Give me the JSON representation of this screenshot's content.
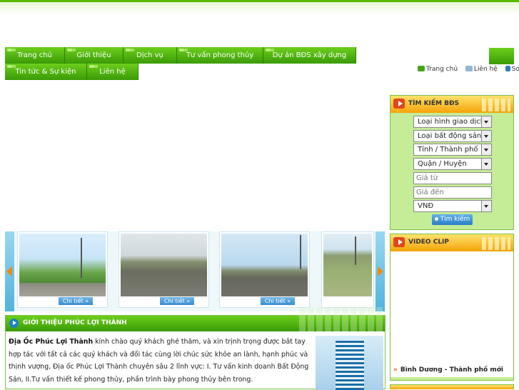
{
  "nav": {
    "items": [
      {
        "label": "Trang chủ"
      },
      {
        "label": "Giới thiệu"
      },
      {
        "label": "Dịch vụ"
      },
      {
        "label": "Tư vấn phong thủy"
      },
      {
        "label": "Dự án BĐS xây dựng"
      },
      {
        "label": "Tin tức & Sự kiện"
      },
      {
        "label": "Liên hệ"
      }
    ]
  },
  "toplinks": {
    "home": "Trang chủ",
    "contact": "Liên hệ",
    "sitemap": "Sơ đồ"
  },
  "search": {
    "title": "TÌM KIẾM BĐS",
    "transaction_type": "Loại hình giao dịch",
    "property_type": "Loại bất động sản",
    "province": "Tỉnh / Thành phố",
    "district": "Quận / Huyện",
    "price_from_placeholder": "Giá từ",
    "price_to_placeholder": "Giá đến",
    "currency": "VNĐ",
    "button": "Tìm kiếm"
  },
  "slider": {
    "more_label": "Chi tiết »"
  },
  "intro": {
    "title": "GIỚI THIỆU PHÚC LỢI THÀNH",
    "company": "Địa Ốc Phúc Lợi Thành",
    "text": " kính chào quý khách ghé thăm, và xin trịnh trọng được bắt tay hợp tác với tất cả các quý khách và đối tác cùng lời chúc sức khỏe an lành, hạnh phúc và thịnh vượng, Địa ốc Phúc Lợi Thành chuyên sâu 2 lĩnh vực: I. Tư vấn kinh doanh Bất Động Sản, II.Tư vấn thiết kế phong thủy, phần trình bày phong thủy bên trong."
  },
  "video": {
    "title": "VIDEO CLIP",
    "item": "Bình Dương - Thành phố mới"
  },
  "colors": {
    "nav_green": "#4caf10",
    "panel_orange": "#f4a20a",
    "panel_bg": "#c5ec97",
    "link_blue": "#2a7fc7"
  },
  "icons": {
    "home": "home-icon",
    "contact": "contact-icon",
    "sitemap": "sitemap-icon",
    "arrow": "arrow-icon"
  }
}
